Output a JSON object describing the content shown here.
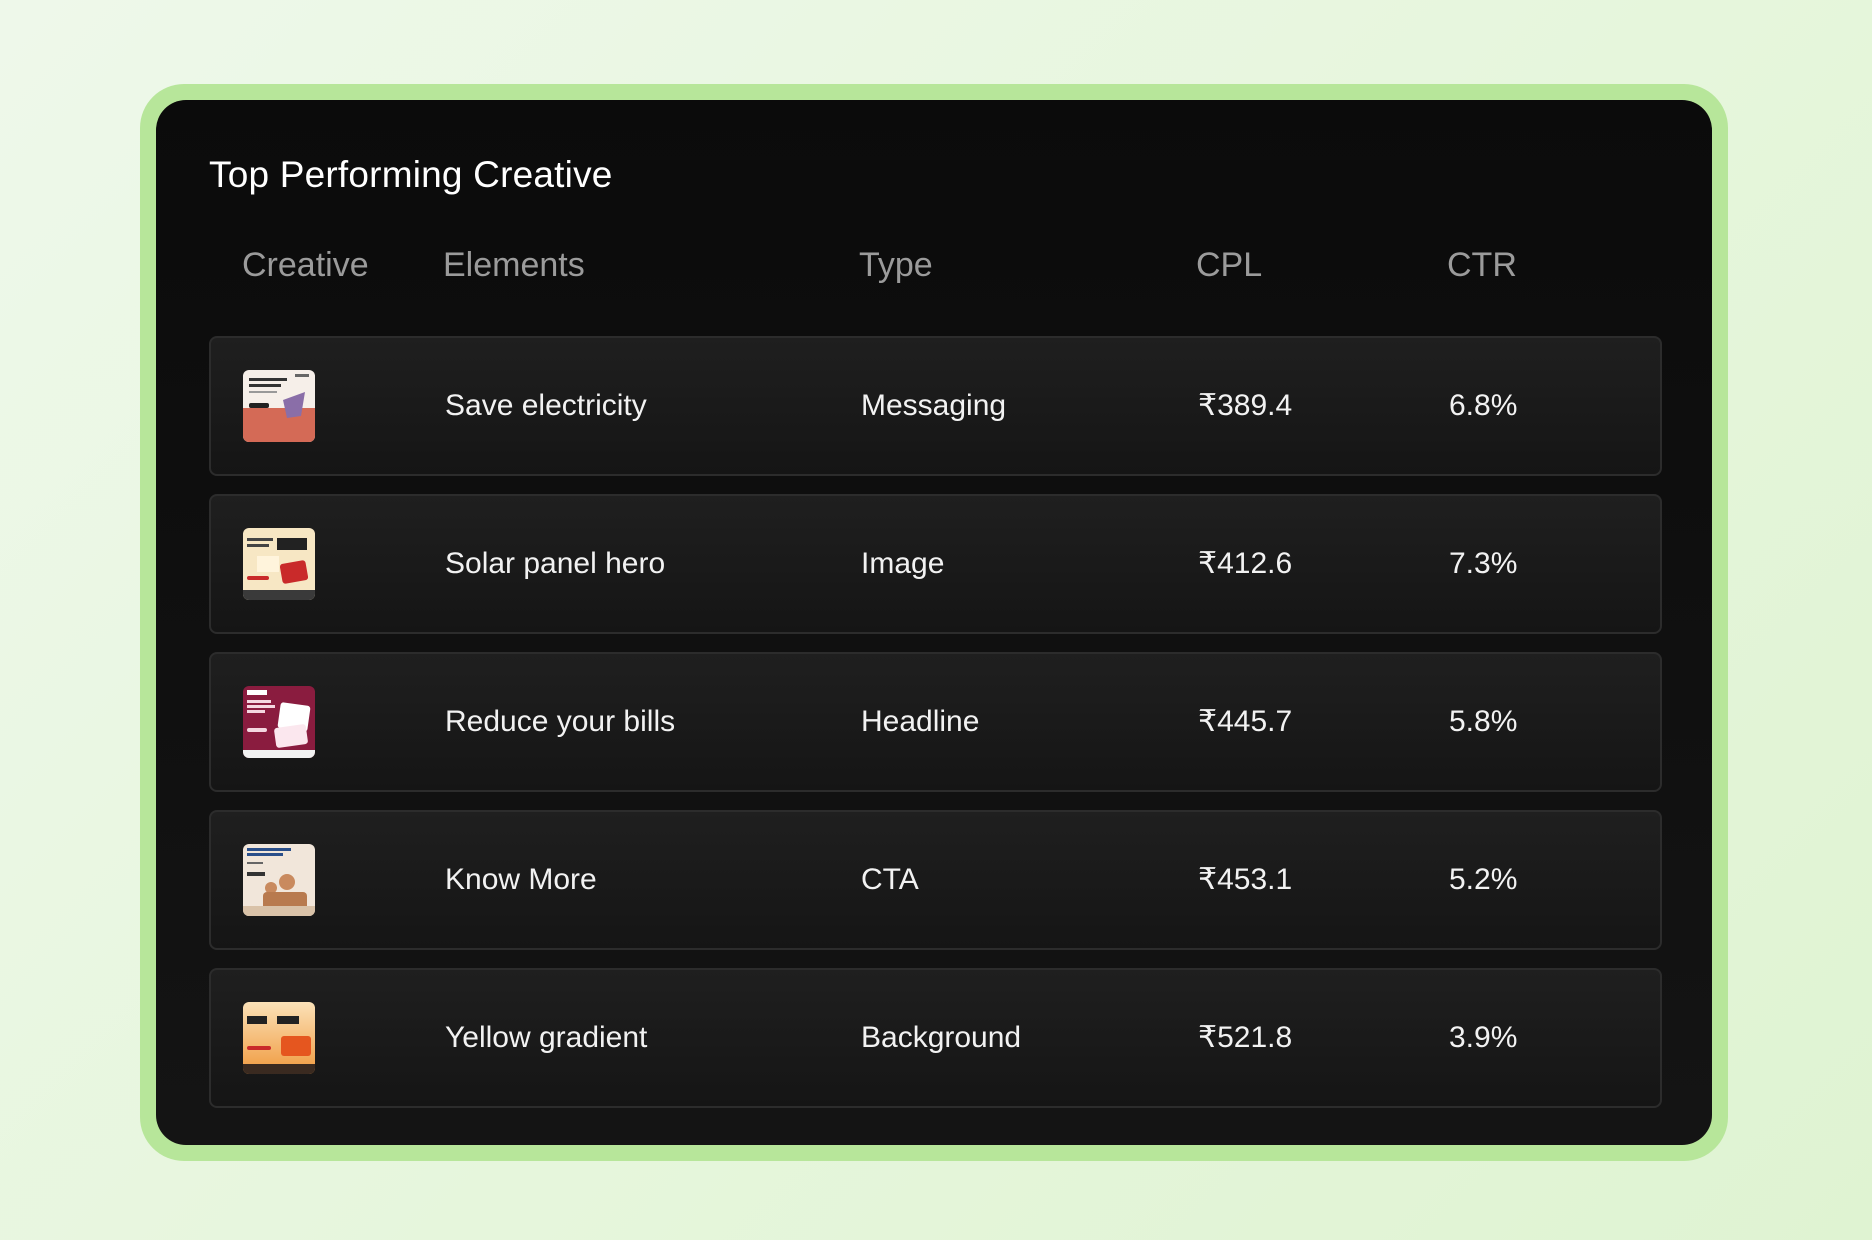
{
  "card": {
    "title": "Top Performing Creative"
  },
  "table": {
    "headers": {
      "creative": "Creative",
      "elements": "Elements",
      "type": "Type",
      "cpl": "CPL",
      "ctr": "CTR"
    },
    "rows": [
      {
        "element": "Save electricity",
        "type": "Messaging",
        "cpl": "₹389.4",
        "ctr": "6.8%",
        "thumb_icon": "creative-thumbnail-save-electricity",
        "thumb_color": "#d46a56"
      },
      {
        "element": "Solar panel hero",
        "type": "Image",
        "cpl": "₹412.6",
        "ctr": "7.3%",
        "thumb_icon": "creative-thumbnail-solar-panel-hero",
        "thumb_color": "#f3dcae"
      },
      {
        "element": "Reduce your bills",
        "type": "Headline",
        "cpl": "₹445.7",
        "ctr": "5.8%",
        "thumb_icon": "creative-thumbnail-reduce-your-bills",
        "thumb_color": "#8a1c3f"
      },
      {
        "element": "Know More",
        "type": "CTA",
        "cpl": "₹453.1",
        "ctr": "5.2%",
        "thumb_icon": "creative-thumbnail-know-more",
        "thumb_color": "#f1e6da"
      },
      {
        "element": "Yellow gradient",
        "type": "Background",
        "cpl": "₹521.8",
        "ctr": "3.9%",
        "thumb_icon": "creative-thumbnail-yellow-gradient",
        "thumb_color": "#f2b45c"
      }
    ]
  },
  "colors": {
    "page_background": "#e6f6dc",
    "frame_border": "#b7e69a",
    "card_background": "#0b0b0b",
    "row_border": "#2c2c2c",
    "header_text": "#9b9b9b",
    "body_text": "#f2f2f2"
  }
}
